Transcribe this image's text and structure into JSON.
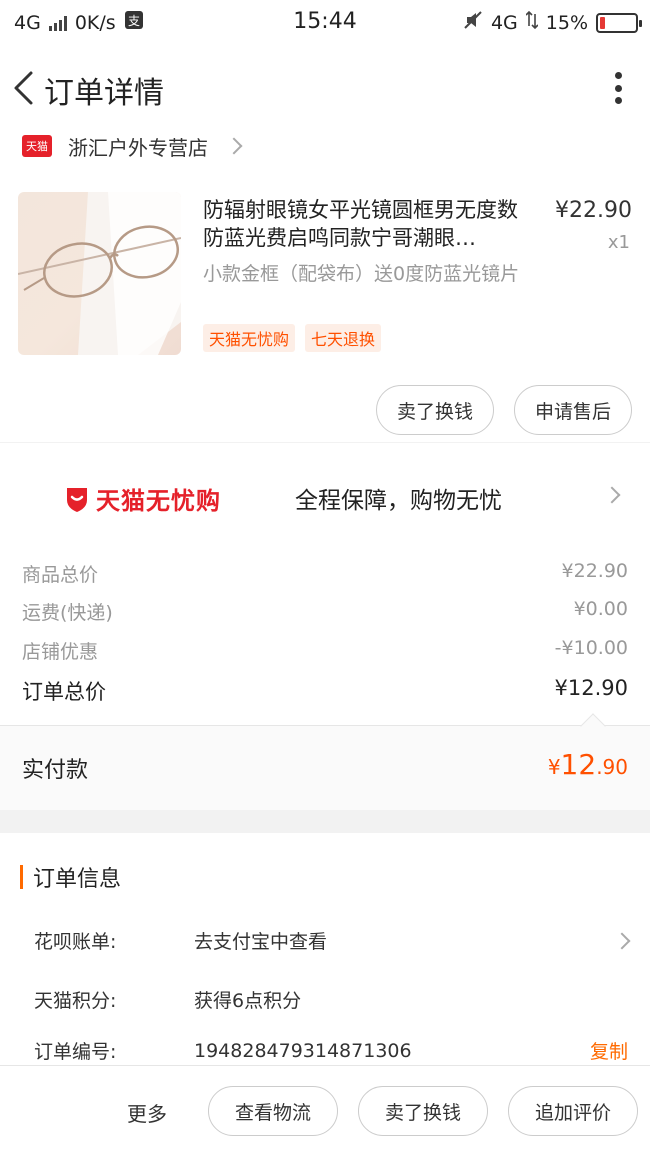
{
  "status_bar": {
    "network_left": "4G",
    "speed": "0K/s",
    "time": "15:44",
    "network_right": "4G",
    "battery": "15%",
    "battery_level": 0.15,
    "battery_color": "#e53935"
  },
  "nav": {
    "title": "订单详情",
    "back_icon": "chevron-left-icon",
    "more_icon": "more-vertical-icon"
  },
  "shop": {
    "badge": "天猫",
    "name": "浙汇户外专营店"
  },
  "product": {
    "title": "防辐射眼镜女平光镜圆框男无度数防蓝光费启鸣同款宁哥潮眼…",
    "price": "¥22.90",
    "quantity": "x1",
    "spec": "小款金框（配袋布）送0度防蓝光镜片",
    "tags": [
      "天猫无忧购",
      "七天退换"
    ],
    "actions": [
      "卖了换钱",
      "申请售后"
    ]
  },
  "banner": {
    "logo_text": "天猫无忧购",
    "slogan": "全程保障，购物无忧"
  },
  "summary": {
    "rows": [
      {
        "label": "商品总价",
        "value": "¥22.90"
      },
      {
        "label": "运费(快递)",
        "value": "¥0.00"
      },
      {
        "label": "店铺优惠",
        "value": "-¥10.00"
      }
    ],
    "total_label": "订单总价",
    "total_value": "¥12.90",
    "paid_label": "实付款",
    "paid_currency": "¥",
    "paid_integer": "12",
    "paid_decimal": ".90"
  },
  "order_info": {
    "title": "订单信息",
    "rows": [
      {
        "label": "花呗账单:",
        "value": "去支付宝中查看"
      },
      {
        "label": "天猫积分:",
        "value": "获得6点积分"
      },
      {
        "label": "订单编号:",
        "value": "1948284793148713​06"
      }
    ],
    "copy_label": "复制"
  },
  "bottom_bar": {
    "more": "更多",
    "buttons": [
      "查看物流",
      "卖了换钱",
      "追加评价"
    ]
  },
  "colors": {
    "accent": "#ff5000",
    "tmall_red": "#e5212a",
    "info_bar": "#ff6a00"
  }
}
